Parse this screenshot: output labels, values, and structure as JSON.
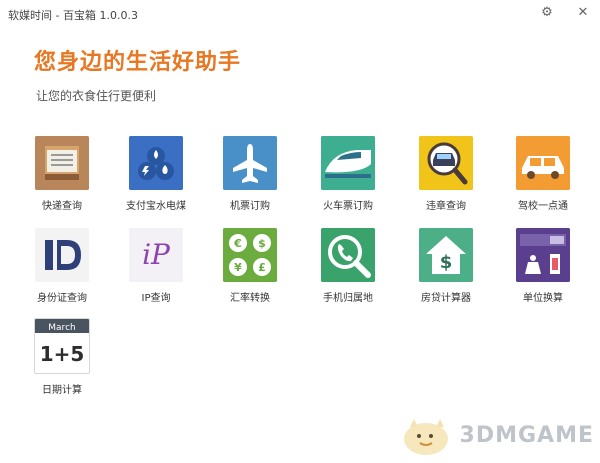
{
  "window": {
    "title": "软媒时间 - 百宝箱 1.0.0.3",
    "close_glyph": "✕",
    "settings_glyph": "⚙"
  },
  "header": {
    "headline": "您身边的生活好助手",
    "subline": "让您的衣食住行更便利"
  },
  "tools": [
    {
      "label": "快递查询",
      "icon": "package-icon",
      "color": "#b8865a"
    },
    {
      "label": "支付宝水电煤",
      "icon": "utilities-icon",
      "color": "#3a6fc4"
    },
    {
      "label": "机票订购",
      "icon": "airplane-icon",
      "color": "#4a90c8"
    },
    {
      "label": "火车票订购",
      "icon": "train-icon",
      "color": "#3dae8f"
    },
    {
      "label": "违章查询",
      "icon": "car-search-icon",
      "color": "#f0c419"
    },
    {
      "label": "驾校一点通",
      "icon": "driving-school-icon",
      "color": "#f39c33"
    },
    {
      "label": "身份证查询",
      "icon": "id-card-icon",
      "color": "#3f5aa8"
    },
    {
      "label": "IP查询",
      "icon": "ip-icon",
      "color": "#8e44ad"
    },
    {
      "label": "汇率转换",
      "icon": "currency-icon",
      "color": "#6cab3e"
    },
    {
      "label": "手机归属地",
      "icon": "phone-search-icon",
      "color": "#3aa36b"
    },
    {
      "label": "房贷计算器",
      "icon": "mortgage-calculator-icon",
      "color": "#4caf87"
    },
    {
      "label": "单位换算",
      "icon": "unit-conversion-icon",
      "color": "#5b3f8f"
    },
    {
      "label": "日期计算",
      "icon": "calendar-icon",
      "color": "#4a5360"
    }
  ],
  "calendar_icon": {
    "month": "March",
    "expr": "1+5"
  },
  "ip_icon_text": "iP",
  "mortgage_icon_text": "$",
  "watermark": {
    "text": "3DMGAME"
  }
}
